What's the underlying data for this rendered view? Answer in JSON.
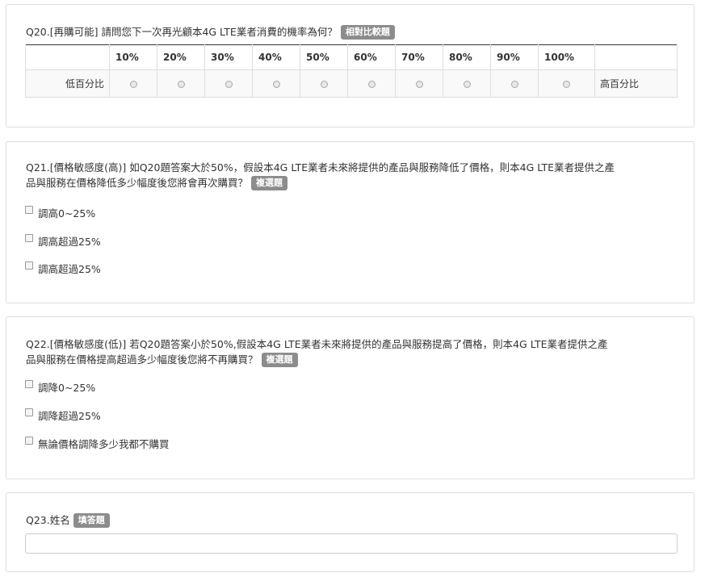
{
  "q20": {
    "title": "Q20.[再購可能] 請問您下一次再光顧本4G LTE業者消費的機率為何？",
    "badge": "相對比較題",
    "scale": [
      "10%",
      "20%",
      "30%",
      "40%",
      "50%",
      "60%",
      "70%",
      "80%",
      "90%",
      "100%"
    ],
    "low_label": "低百分比",
    "high_label": "高百分比"
  },
  "q21": {
    "title_line1": "Q21.[價格敏感度(高)] 如Q20題答案大於50%，假設本4G LTE業者未來將提供的產品與服務降低了價格，則本4G LTE業者提供之產",
    "title_line2": "品與服務在價格降低多少幅度後您將會再次購買？",
    "badge": "複選題",
    "options": [
      "調高0~25%",
      "調高超過25%",
      "調高超過25%"
    ]
  },
  "q22": {
    "title_line1": "Q22.[價格敏感度(低)] 若Q20題答案小於50%,假設本4G LTE業者未來將提供的產品與服務提高了價格，則本4G LTE業者提供之產",
    "title_line2": "品與服務在價格提高超過多少幅度後您將不再購買？",
    "badge": "複選題",
    "options": [
      "調降0~25%",
      "調降超過25%",
      "無論價格調降多少我都不購買"
    ]
  },
  "q23": {
    "title": "Q23.姓名",
    "badge": "填答題",
    "value": ""
  }
}
